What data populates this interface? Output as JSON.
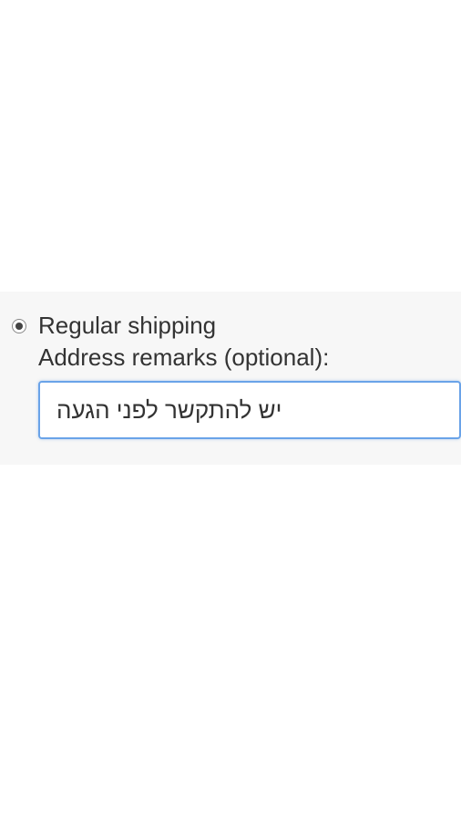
{
  "shipping": {
    "option_label": "Regular shipping",
    "option_selected": true
  },
  "remarks": {
    "label": "Address remarks (optional):",
    "value": "יש להתקשר לפני הגעה"
  }
}
